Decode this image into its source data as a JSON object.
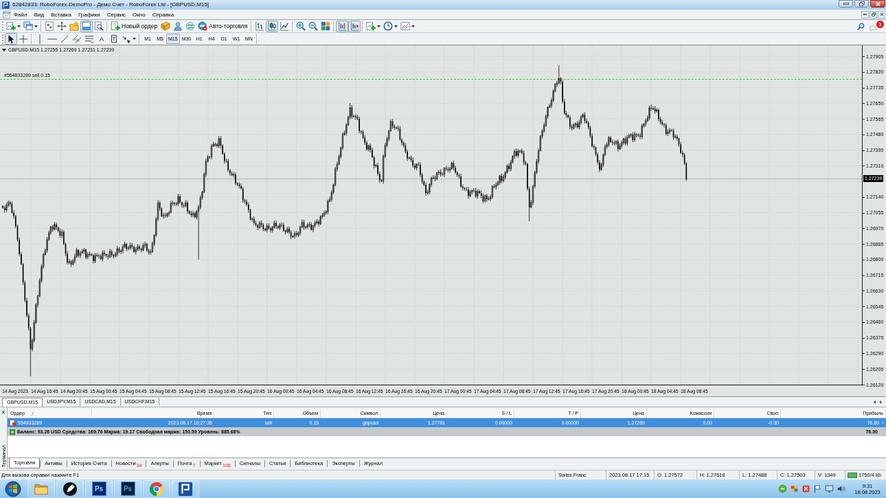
{
  "window": {
    "title": "62842833: RoboForex-DemoPro - Демо Счет - RoboForex Ltd - [GBPUSD,M15]"
  },
  "menu": [
    "Файл",
    "Вид",
    "Вставка",
    "Графики",
    "Сервис",
    "Окно",
    "Справка"
  ],
  "toolbar": [
    [
      {
        "kind": "new-chart",
        "dropdown": true,
        "pressed": false
      },
      {
        "kind": "profiles",
        "dropdown": true,
        "pressed": false
      }
    ],
    [
      {
        "kind": "market-watch",
        "pressed": false
      },
      {
        "kind": "data-window",
        "pressed": false
      },
      {
        "kind": "navigator",
        "pressed": false
      },
      {
        "kind": "terminal",
        "pressed": true
      },
      {
        "kind": "tester",
        "pressed": false
      }
    ],
    [
      {
        "kind": "new-order",
        "label": "Новый ордер",
        "pressed": false
      },
      {
        "kind": "editor",
        "pressed": false
      },
      {
        "kind": "signals",
        "pressed": false
      },
      {
        "kind": "market",
        "pressed": false
      },
      {
        "kind": "autotrading",
        "label": "Авто-торговля",
        "pressed": false
      }
    ],
    [
      {
        "kind": "bar-chart",
        "pressed": false
      },
      {
        "kind": "candlesticks",
        "pressed": true
      },
      {
        "kind": "line-chart",
        "pressed": false
      }
    ],
    [
      {
        "kind": "zoom-in",
        "pressed": false
      },
      {
        "kind": "zoom-out",
        "pressed": false
      },
      {
        "kind": "tile",
        "pressed": false
      }
    ],
    [
      {
        "kind": "chart-shift",
        "pressed": true
      },
      {
        "kind": "autoscroll",
        "pressed": true
      }
    ],
    [
      {
        "kind": "indicators",
        "dropdown": true,
        "pressed": false
      },
      {
        "kind": "periods",
        "dropdown": true,
        "pressed": false
      },
      {
        "kind": "templates",
        "dropdown": true,
        "pressed": false
      }
    ]
  ],
  "notifications": {
    "count": "1"
  },
  "drawing_tools": [
    [
      {
        "kind": "cursor",
        "pressed": true
      },
      {
        "kind": "crosshair",
        "pressed": false
      }
    ],
    [
      {
        "kind": "vertical-line",
        "pressed": false
      },
      {
        "kind": "horizontal-line",
        "pressed": false
      },
      {
        "kind": "trend-line",
        "pressed": false
      },
      {
        "kind": "channel",
        "pressed": false
      },
      {
        "kind": "fibonacci",
        "pressed": false
      },
      {
        "kind": "text",
        "label": "A",
        "pressed": false
      },
      {
        "kind": "text-label",
        "label": "T",
        "pressed": false
      },
      {
        "kind": "arrows",
        "dropdown": true,
        "pressed": false
      }
    ]
  ],
  "timeframes": [
    {
      "label": "M1",
      "selected": false
    },
    {
      "label": "M5",
      "selected": false
    },
    {
      "label": "M15",
      "selected": true
    },
    {
      "label": "M30",
      "selected": false
    },
    {
      "label": "H1",
      "selected": false
    },
    {
      "label": "H4",
      "selected": false
    },
    {
      "label": "D1",
      "selected": false
    },
    {
      "label": "W1",
      "selected": false
    },
    {
      "label": "MN",
      "selected": false
    }
  ],
  "chart": {
    "header": "GBPUSD.M15 1.27255 1.27269 1.27231 1.27239",
    "order_label": "#554833289 sell 0.15",
    "price_labels_upper": [
      "1.27905",
      "1.27820",
      "1.27735",
      "1.27650",
      "1.27565",
      "1.27480",
      "1.27395",
      "1.27310"
    ],
    "current_price": "1.27239",
    "price_labels_lower": [
      "1.27140",
      "1.27055",
      "1.26970",
      "1.26885",
      "1.26800",
      "1.26715",
      "1.26630",
      "1.26545",
      "1.26460",
      "1.26375",
      "1.26290",
      "1.26205",
      "1.26120"
    ],
    "time_labels": [
      "14 Aug 2023",
      "14 Aug 16:45",
      "14 Aug 20:45",
      "15 Aug 00:45",
      "15 Aug 04:45",
      "15 Aug 08:45",
      "15 Aug 12:45",
      "15 Aug 16:45",
      "15 Aug 20:45",
      "16 Aug 00:45",
      "16 Aug 04:45",
      "16 Aug 08:45",
      "16 Aug 12:45",
      "16 Aug 16:45",
      "16 Aug 20:45",
      "17 Aug 00:45",
      "17 Aug 04:45",
      "17 Aug 08:45",
      "17 Aug 12:45",
      "17 Aug 16:45",
      "17 Aug 20:45",
      "18 Aug 00:45",
      "18 Aug 04:45",
      "18 Aug 08:45"
    ]
  },
  "chart_tabs": [
    {
      "label": "GBPUSD,M15",
      "selected": true
    },
    {
      "label": "USDJPY,M15",
      "selected": false
    },
    {
      "label": "USDCAD,M15",
      "selected": false
    },
    {
      "label": "USDCHF,M15",
      "selected": false
    }
  ],
  "terminal": {
    "title": "Терминал",
    "columns": [
      "Ордер",
      "Время",
      "Тип",
      "Объем",
      "Символ",
      "Цена",
      "S / L",
      "T / P",
      "Цена",
      "Комиссия",
      "Своп",
      "Прибыль"
    ],
    "rows": [
      {
        "selected": true,
        "cells": [
          "554833289",
          "2023.08.17 16:27:35",
          "sell",
          "0.15",
          "gbpusd",
          "1.27781",
          "0.00000",
          "0.00000",
          "1.27269",
          "0.00",
          "-0.30",
          "76.80"
        ]
      }
    ],
    "summary": {
      "text": "Баланс: 93.26 USD Средства: 169.76 Маржа: 19.17 Свободная маржа: 150.59 Уровень: 885.68%",
      "profit": "76.50"
    },
    "tabs": [
      {
        "label": "Торговля",
        "selected": true
      },
      {
        "label": "Активы",
        "selected": false
      },
      {
        "label": "История Счета",
        "selected": false
      },
      {
        "label": "Новости",
        "count": "34",
        "selected": false
      },
      {
        "label": "Алерты",
        "selected": false
      },
      {
        "label": "Почта",
        "count": "7",
        "selected": false
      },
      {
        "label": "Маркет",
        "count": "108",
        "selected": false
      },
      {
        "label": "Сигналы",
        "selected": false
      },
      {
        "label": "Статьи",
        "selected": false
      },
      {
        "label": "Библиотека",
        "selected": false
      },
      {
        "label": "Эксперты",
        "selected": false
      },
      {
        "label": "Журнал",
        "selected": false
      }
    ]
  },
  "status_bar": {
    "help": "Для вызова справки нажмите F1",
    "fields": [
      "Swiss Franc",
      "2023.08.17 17:15",
      "O: 1.27572",
      "H: 1.27618",
      "L: 1.27488",
      "C: 1.27503",
      "V: 1349"
    ],
    "traffic": "1750/4 kb"
  },
  "taskbar": {
    "apps": [
      {
        "kind": "folder"
      },
      {
        "kind": "pen"
      },
      {
        "kind": "photoshop-cs",
        "label": "Ps"
      },
      {
        "kind": "photoshop-cc",
        "label": "Ps"
      },
      {
        "kind": "browser"
      },
      {
        "kind": "trading"
      }
    ],
    "time": "9:31",
    "date": "18.08.2023"
  }
}
